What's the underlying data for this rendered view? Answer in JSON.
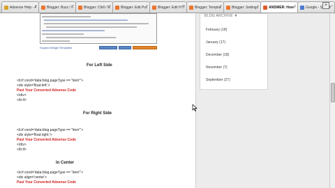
{
  "tabs": [
    {
      "label": "Adsense Help - Adsense",
      "favicon_color": "#d6a12b",
      "active": false
    },
    {
      "label": "Blogger: Buzz / New Tab",
      "favicon_color": "#e8772e",
      "active": false
    },
    {
      "label": "Blogger: Chill / New Tab",
      "favicon_color": "#e8772e",
      "active": false
    },
    {
      "label": "Blogger: Edit Post",
      "favicon_color": "#e8772e",
      "active": false
    },
    {
      "label": "Blogger: Edit HTML",
      "favicon_color": "#e8772e",
      "active": false
    },
    {
      "label": "Blogger: Template",
      "favicon_color": "#e8772e",
      "active": false
    },
    {
      "label": "Blogger: Settings",
      "favicon_color": "#e8772e",
      "active": false
    },
    {
      "label": "ANSWER: How to A...",
      "favicon_color": "#e05a2b",
      "active": true
    },
    {
      "label": "Google - Search",
      "favicon_color": "#4a7bd0",
      "active": false
    }
  ],
  "browser_controls": {
    "new_tab": "+",
    "close": "x"
  },
  "screenshot_link": "Expand Widget Templates",
  "sections": [
    {
      "heading": "For Left Side",
      "lines": [
        {
          "text": "<b:if cond='data:blog.pageType == \"item\"'>",
          "red": false
        },
        {
          "text": "<div style='float:left;'>",
          "red": false
        },
        {
          "text": "Past Your Converted Adsense Code",
          "red": true
        },
        {
          "text": "</div>",
          "red": false
        },
        {
          "text": "</b:if>",
          "red": false
        }
      ]
    },
    {
      "heading": "For Right Side",
      "lines": [
        {
          "text": "<b:if cond='data:blog.pageType == \"item\"'>",
          "red": false
        },
        {
          "text": "<div style='float:right;'>",
          "red": false
        },
        {
          "text": "Past Your Converted Adsense Code",
          "red": true
        },
        {
          "text": "</div>",
          "red": false
        },
        {
          "text": "</b:if>",
          "red": false
        }
      ]
    },
    {
      "heading": "In Center",
      "lines": [
        {
          "text": "<b:if cond='data:blog.pageType == \"item\"'>",
          "red": false
        },
        {
          "text": "<div align='center'>",
          "red": false
        },
        {
          "text": "Past Your Converted Adsense Code",
          "red": true
        }
      ]
    }
  ],
  "sidebar": {
    "archive_title": "BLOG ARCHIVE ▼",
    "items": [
      "February (18)",
      "January (17)",
      "December (18)",
      "November (7)",
      "September (27)"
    ]
  }
}
